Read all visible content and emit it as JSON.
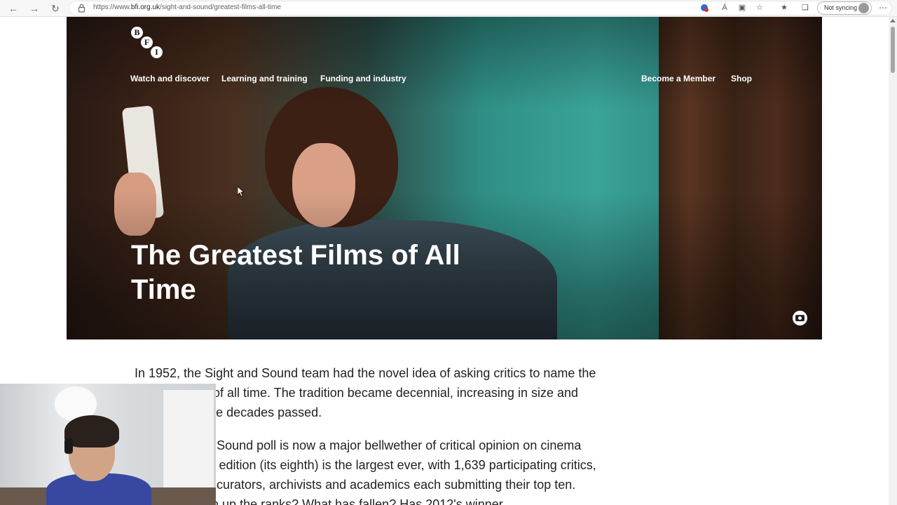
{
  "browser": {
    "url_prefix": "https://www.",
    "url_host": "bfi.org.uk",
    "url_path": "/sight-and-sound/greatest-films-all-time",
    "profile_label": "Not syncing"
  },
  "site": {
    "logo_letters": [
      "B",
      "F",
      "I"
    ],
    "nav_left": [
      "Watch and discover",
      "Learning and training",
      "Funding and industry"
    ],
    "nav_right": [
      "Become a Member",
      "Shop"
    ]
  },
  "hero": {
    "title": "The Greatest Films of All Time"
  },
  "article": {
    "paragraph1": "In 1952, the Sight and Sound team had the novel idea of asking critics to name the greatest films of all time. The tradition became decennial, increasing in size and influence as the decades passed.",
    "paragraph2": "The Sight and Sound poll is now a major bellwether of critical opinion on cinema and this year's edition (its eighth) is the largest ever, with 1,639 participating critics, programmers, curators, archivists and academics each submitting their top ten. What has risen up the ranks? What has fallen? Has 2012's winner"
  },
  "colors": {
    "chrome_bg": "#f7f7f7",
    "hero_teal": "#2f8f86",
    "text": "#222222"
  }
}
